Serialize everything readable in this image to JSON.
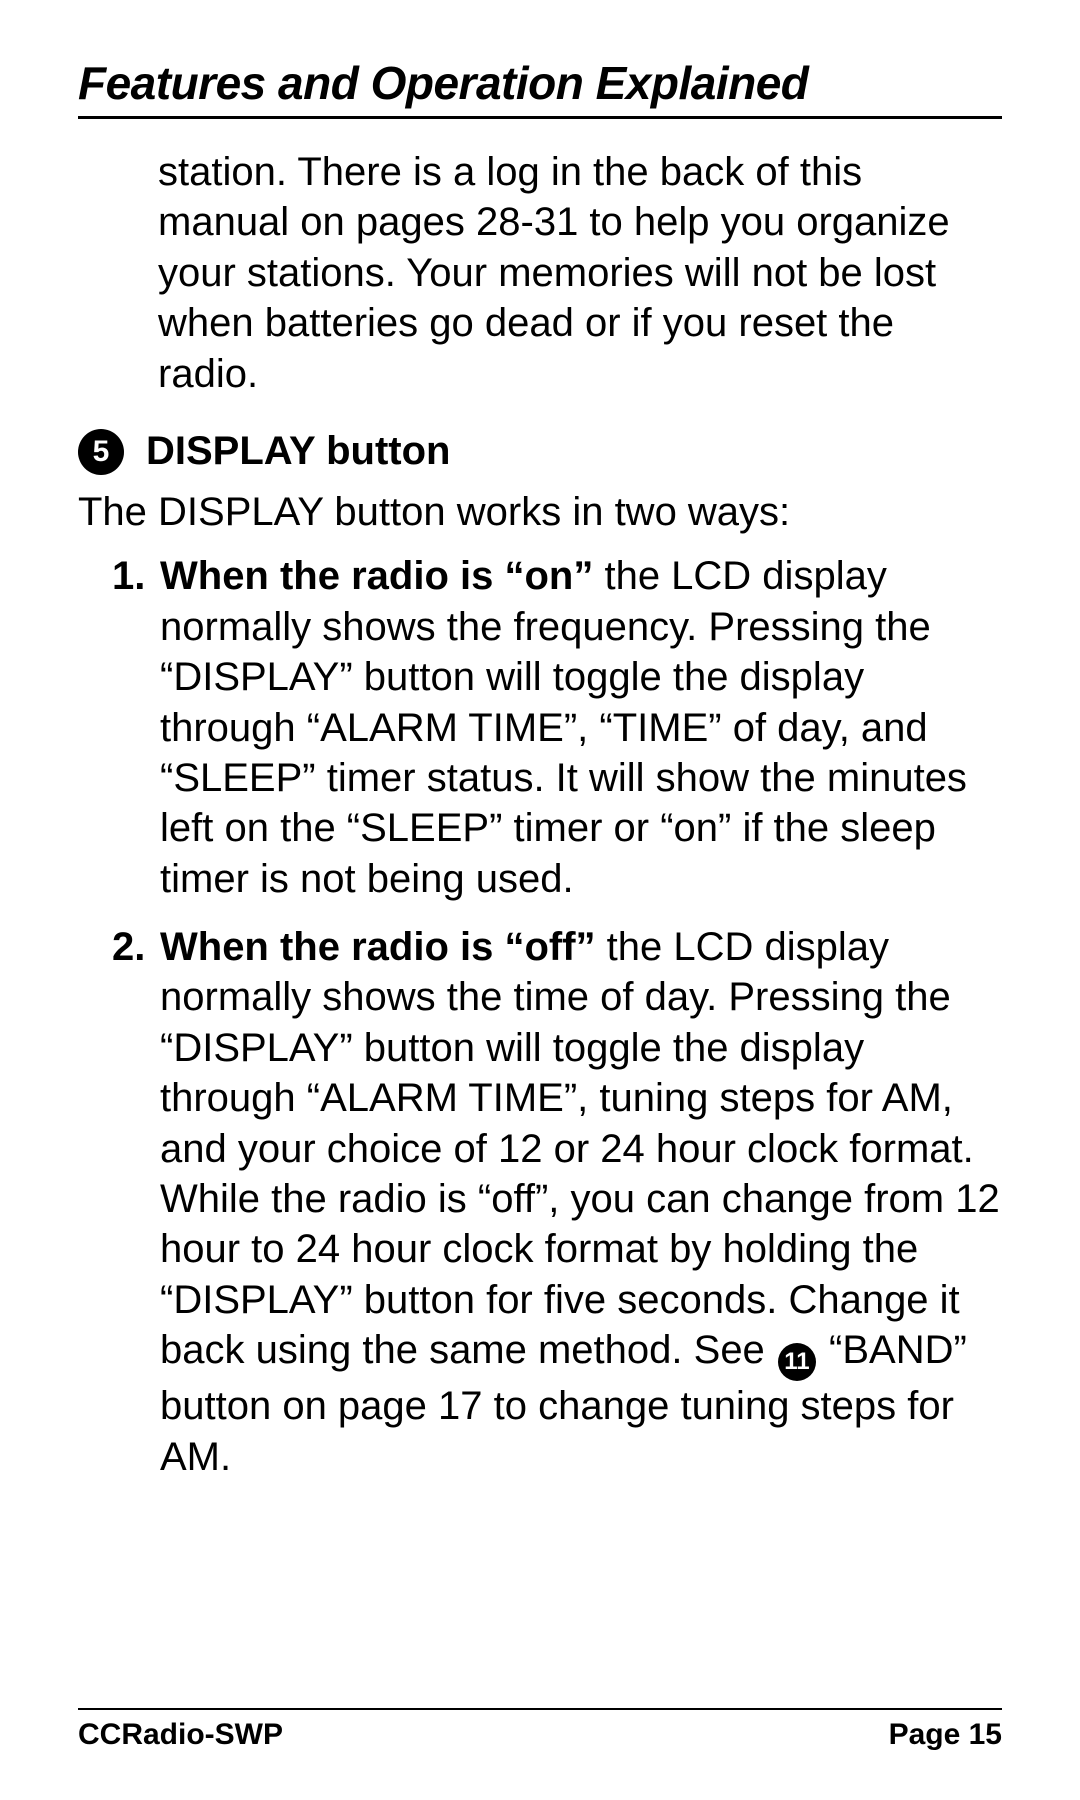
{
  "header": {
    "section_title": "Features and Operation Explained"
  },
  "carry_paragraph": "station. There is a log in the back of this manual on pages 28-31 to help you organize your stations. Your memories will not be lost when batteries go dead or if you reset the radio.",
  "item5": {
    "bullet_number": "5",
    "title": "DISPLAY button",
    "intro": "The DISPLAY button works in two ways:",
    "points": [
      {
        "lead": "When the radio is “on”",
        "rest": " the LCD display normally shows the frequency. Pressing the “DISPLAY” button will toggle the dis­play through “ALARM TIME”, “TIME” of day, and “SLEEP” timer status. It will show the minutes left on the “SLEEP” timer or “on” if the sleep timer is not being used."
      },
      {
        "lead": "When the radio is “off”",
        "rest_part1": " the LCD display normally shows the time of day. Pressing the “DISPLAY” button will toggle the dis­play through “ALARM TIME”, tuning steps for AM, and your choice of 12 or 24 hour clock format. While the radio is “off”, you can change from 12 hour to 24 hour clock format by holding the “DIS­PLAY” button for five seconds. Change it back using the same method. See ",
        "ref_num": "11",
        "rest_part2": " “BAND” button on page 17 to change tuning steps for AM."
      }
    ]
  },
  "footer": {
    "left": "CCRadio-SWP",
    "right": "Page 15"
  }
}
